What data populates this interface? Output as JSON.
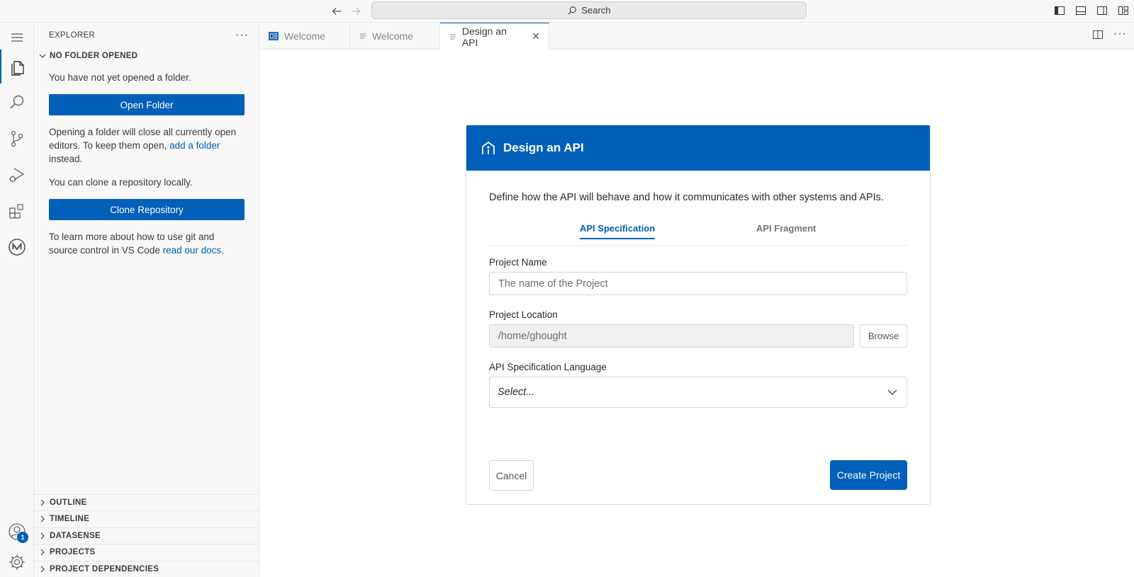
{
  "titlebar": {
    "search_label": "Search"
  },
  "activitybar": {
    "icons": [
      "menu-icon",
      "explorer-icon",
      "search-icon",
      "source-control-icon",
      "run-debug-icon",
      "extensions-icon",
      "mulesoft-icon",
      "account-icon",
      "settings-icon"
    ],
    "account_badge": "1"
  },
  "sidebar": {
    "title": "EXPLORER",
    "section_title": "NO FOLDER OPENED",
    "no_folder_text": "You have not yet opened a folder.",
    "open_folder_label": "Open Folder",
    "opening_text_1": "Opening a folder will close all currently open editors. To keep them open, ",
    "opening_link": "add a folder",
    "opening_text_2": " instead.",
    "clone_text": "You can clone a repository locally.",
    "clone_label": "Clone Repository",
    "learn_text": "To learn more about how to use git and source control in VS Code ",
    "learn_link": "read our docs",
    "learn_end": ".",
    "collapsed_sections": [
      "OUTLINE",
      "TIMELINE",
      "DATASENSE",
      "PROJECTS",
      "PROJECT DEPENDENCIES"
    ]
  },
  "tabs": [
    {
      "label": "Welcome",
      "active": false
    },
    {
      "label": "Welcome",
      "active": false
    },
    {
      "label": "Design an API",
      "active": true
    }
  ],
  "card": {
    "title": "Design an API",
    "description": "Define how the API will behave and how it communicates with other systems and APIs.",
    "subtabs": [
      "API Specification",
      "API Fragment"
    ],
    "active_subtab": "API Specification",
    "project_name_label": "Project Name",
    "project_name_placeholder": "The name of the Project",
    "project_location_label": "Project Location",
    "project_location_value": "/home/ghought",
    "browse_label": "Browse",
    "language_label": "API Specification Language",
    "language_value": "Select...",
    "cancel_label": "Cancel",
    "create_label": "Create Project"
  },
  "colors": {
    "accent": "#005fb8"
  }
}
